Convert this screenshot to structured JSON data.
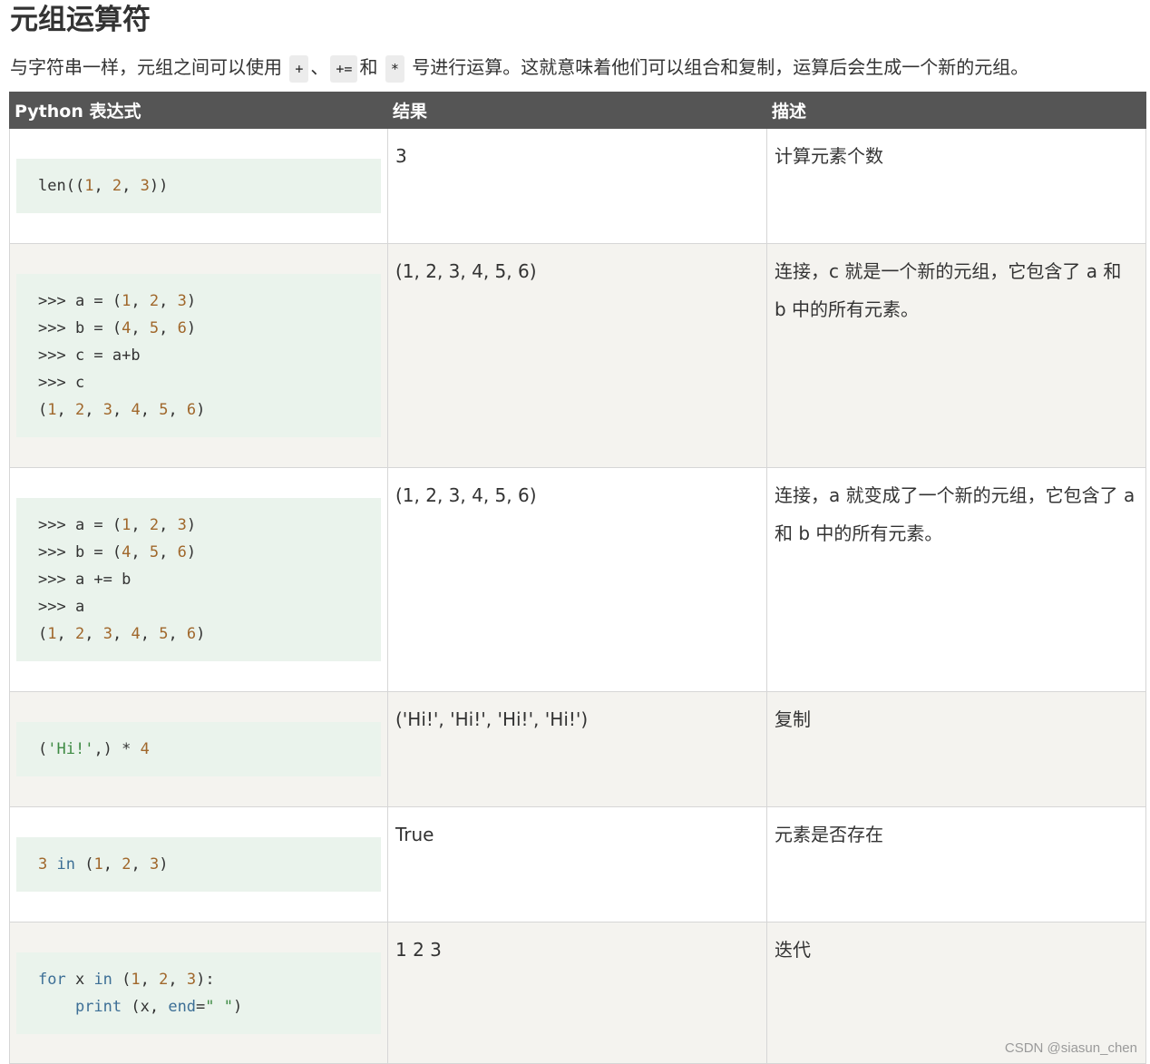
{
  "title": "元组运算符",
  "intro": {
    "text_before": "与字符串一样，元组之间可以使用 ",
    "op_plus": "+",
    "sep": "、",
    "op_plus_assign": "+=",
    "text_and": "和 ",
    "op_star": "*",
    "text_after": " 号进行运算。这就意味着他们可以组合和复制，运算后会生成一个新的元组。"
  },
  "table": {
    "headers": [
      "Python 表达式",
      "结果",
      "描述"
    ],
    "rows": [
      {
        "code": [
          [
            {
              "t": "len(("
            },
            {
              "t": "1",
              "c": "num"
            },
            {
              "t": ", "
            },
            {
              "t": "2",
              "c": "num"
            },
            {
              "t": ", "
            },
            {
              "t": "3",
              "c": "num"
            },
            {
              "t": "))"
            }
          ]
        ],
        "result": "3",
        "description": "计算元素个数"
      },
      {
        "code": [
          [
            {
              "t": ">>> a = ("
            },
            {
              "t": "1",
              "c": "num"
            },
            {
              "t": ", "
            },
            {
              "t": "2",
              "c": "num"
            },
            {
              "t": ", "
            },
            {
              "t": "3",
              "c": "num"
            },
            {
              "t": ")"
            }
          ],
          [
            {
              "t": ">>> b = ("
            },
            {
              "t": "4",
              "c": "num"
            },
            {
              "t": ", "
            },
            {
              "t": "5",
              "c": "num"
            },
            {
              "t": ", "
            },
            {
              "t": "6",
              "c": "num"
            },
            {
              "t": ")"
            }
          ],
          [
            {
              "t": ">>> c = a+b"
            }
          ],
          [
            {
              "t": ">>> c"
            }
          ],
          [
            {
              "t": "("
            },
            {
              "t": "1",
              "c": "num"
            },
            {
              "t": ", "
            },
            {
              "t": "2",
              "c": "num"
            },
            {
              "t": ", "
            },
            {
              "t": "3",
              "c": "num"
            },
            {
              "t": ", "
            },
            {
              "t": "4",
              "c": "num"
            },
            {
              "t": ", "
            },
            {
              "t": "5",
              "c": "num"
            },
            {
              "t": ", "
            },
            {
              "t": "6",
              "c": "num"
            },
            {
              "t": ")"
            }
          ]
        ],
        "result": "(1, 2, 3, 4, 5, 6)",
        "description": "连接，c 就是一个新的元组，它包含了 a 和 b 中的所有元素。"
      },
      {
        "code": [
          [
            {
              "t": ">>> a = ("
            },
            {
              "t": "1",
              "c": "num"
            },
            {
              "t": ", "
            },
            {
              "t": "2",
              "c": "num"
            },
            {
              "t": ", "
            },
            {
              "t": "3",
              "c": "num"
            },
            {
              "t": ")"
            }
          ],
          [
            {
              "t": ">>> b = ("
            },
            {
              "t": "4",
              "c": "num"
            },
            {
              "t": ", "
            },
            {
              "t": "5",
              "c": "num"
            },
            {
              "t": ", "
            },
            {
              "t": "6",
              "c": "num"
            },
            {
              "t": ")"
            }
          ],
          [
            {
              "t": ">>> a += b"
            }
          ],
          [
            {
              "t": ">>> a"
            }
          ],
          [
            {
              "t": "("
            },
            {
              "t": "1",
              "c": "num"
            },
            {
              "t": ", "
            },
            {
              "t": "2",
              "c": "num"
            },
            {
              "t": ", "
            },
            {
              "t": "3",
              "c": "num"
            },
            {
              "t": ", "
            },
            {
              "t": "4",
              "c": "num"
            },
            {
              "t": ", "
            },
            {
              "t": "5",
              "c": "num"
            },
            {
              "t": ", "
            },
            {
              "t": "6",
              "c": "num"
            },
            {
              "t": ")"
            }
          ]
        ],
        "result": "(1, 2, 3, 4, 5, 6)",
        "description": "连接，a 就变成了一个新的元组，它包含了 a 和 b 中的所有元素。"
      },
      {
        "code": [
          [
            {
              "t": "("
            },
            {
              "t": "'Hi!'",
              "c": "str"
            },
            {
              "t": ",) * "
            },
            {
              "t": "4",
              "c": "num"
            }
          ]
        ],
        "result": "('Hi!', 'Hi!', 'Hi!', 'Hi!')",
        "description": "复制"
      },
      {
        "code": [
          [
            {
              "t": "3",
              "c": "num"
            },
            {
              "t": " "
            },
            {
              "t": "in",
              "c": "kw"
            },
            {
              "t": " ("
            },
            {
              "t": "1",
              "c": "num"
            },
            {
              "t": ", "
            },
            {
              "t": "2",
              "c": "num"
            },
            {
              "t": ", "
            },
            {
              "t": "3",
              "c": "num"
            },
            {
              "t": ")"
            }
          ]
        ],
        "result": "True",
        "description": "元素是否存在"
      },
      {
        "code": [
          [
            {
              "t": "for",
              "c": "kw"
            },
            {
              "t": " x "
            },
            {
              "t": "in",
              "c": "kw"
            },
            {
              "t": " ("
            },
            {
              "t": "1",
              "c": "num"
            },
            {
              "t": ", "
            },
            {
              "t": "2",
              "c": "num"
            },
            {
              "t": ", "
            },
            {
              "t": "3",
              "c": "num"
            },
            {
              "t": "):"
            }
          ],
          [
            {
              "t": "    "
            },
            {
              "t": "print",
              "c": "kw"
            },
            {
              "t": " (x, "
            },
            {
              "t": "end",
              "c": "kw"
            },
            {
              "t": "="
            },
            {
              "t": "\" \"",
              "c": "str"
            },
            {
              "t": ")"
            }
          ]
        ],
        "result": "1 2 3",
        "description": "迭代"
      }
    ]
  },
  "watermark": "CSDN @siasun_chen",
  "colors": {
    "header_bg": "#555555",
    "alt_row_bg": "#f4f3ef",
    "code_bg": "#eaf3ec",
    "number": "#a0672b",
    "string": "#3e8a43",
    "keyword": "#3d6f96"
  }
}
